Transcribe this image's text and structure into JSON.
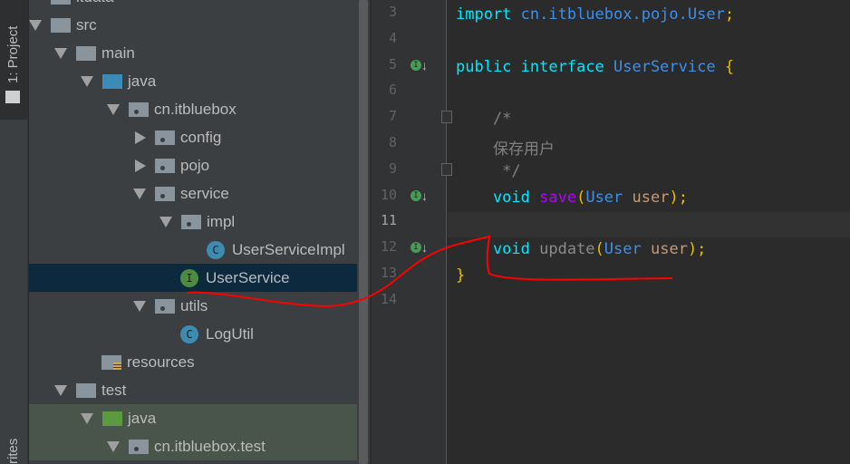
{
  "toolwindow": {
    "project_tab": "1: Project",
    "favorites_tab": "rites"
  },
  "tree": [
    {
      "label": "itdata",
      "kind": "folder",
      "level": 0,
      "arrow": "none"
    },
    {
      "label": "src",
      "kind": "folder",
      "level": 0,
      "arrow": "down"
    },
    {
      "label": "main",
      "kind": "folder",
      "level": 1,
      "arrow": "down"
    },
    {
      "label": "java",
      "kind": "source-folder",
      "level": 2,
      "arrow": "down"
    },
    {
      "label": "cn.itbluebox",
      "kind": "package",
      "level": 3,
      "arrow": "down"
    },
    {
      "label": "config",
      "kind": "package",
      "level": 4,
      "arrow": "right"
    },
    {
      "label": "pojo",
      "kind": "package",
      "level": 4,
      "arrow": "right"
    },
    {
      "label": "service",
      "kind": "package",
      "level": 4,
      "arrow": "down"
    },
    {
      "label": "impl",
      "kind": "package",
      "level": 5,
      "arrow": "down"
    },
    {
      "label": "UserServiceImpl",
      "kind": "class",
      "level": 6,
      "arrow": "none"
    },
    {
      "label": "UserService",
      "kind": "interface",
      "level": 5,
      "arrow": "none",
      "selected": true
    },
    {
      "label": "utils",
      "kind": "package",
      "level": 4,
      "arrow": "down"
    },
    {
      "label": "LogUtil",
      "kind": "class",
      "level": 5,
      "arrow": "none"
    },
    {
      "label": "resources",
      "kind": "resources-folder",
      "level": 2,
      "arrow": "none"
    },
    {
      "label": "test",
      "kind": "folder",
      "level": 1,
      "arrow": "down"
    },
    {
      "label": "java",
      "kind": "test-folder",
      "level": 2,
      "arrow": "down",
      "test": true
    },
    {
      "label": "cn.itbluebox.test",
      "kind": "package",
      "level": 3,
      "arrow": "down",
      "test": true
    }
  ],
  "editor": {
    "current_line": "11",
    "lines": [
      {
        "n": "3",
        "tokens": [
          [
            "kw",
            "import "
          ],
          [
            "ty",
            "cn.itbluebox.pojo.User"
          ],
          [
            "br",
            ";"
          ]
        ]
      },
      {
        "n": "4",
        "tokens": []
      },
      {
        "n": "5",
        "impl": true,
        "tokens": [
          [
            "kw",
            "public interface "
          ],
          [
            "ty",
            "UserService "
          ],
          [
            "br",
            "{"
          ]
        ]
      },
      {
        "n": "6",
        "tokens": []
      },
      {
        "n": "7",
        "fold": "start",
        "tokens": [
          [
            "cm",
            "    /*"
          ]
        ]
      },
      {
        "n": "8",
        "tokens": [
          [
            "cm",
            "    保存用户"
          ]
        ]
      },
      {
        "n": "9",
        "fold": "end",
        "tokens": [
          [
            "cm",
            "     */"
          ]
        ]
      },
      {
        "n": "10",
        "impl": true,
        "tokens": [
          [
            "kw",
            "    void "
          ],
          [
            "fn",
            "save"
          ],
          [
            "br",
            "("
          ],
          [
            "ty",
            "User "
          ],
          [
            "pm",
            "user"
          ],
          [
            "br",
            ");"
          ]
        ]
      },
      {
        "n": "11",
        "tokens": []
      },
      {
        "n": "12",
        "impl": true,
        "tokens": [
          [
            "kw",
            "    void "
          ],
          [
            "gr",
            "update"
          ],
          [
            "br",
            "("
          ],
          [
            "ty",
            "User "
          ],
          [
            "pm",
            "user"
          ],
          [
            "br",
            ");"
          ]
        ]
      },
      {
        "n": "13",
        "tokens": [
          [
            "br",
            "}"
          ]
        ]
      },
      {
        "n": "14",
        "tokens": []
      }
    ]
  },
  "colors": {
    "folder": "#8a949c",
    "source": "#3a8bb5",
    "test": "#5b9b3f",
    "class": "#3d8bb0",
    "interface": "#4b8c3e",
    "annotation": "#ff0000"
  }
}
